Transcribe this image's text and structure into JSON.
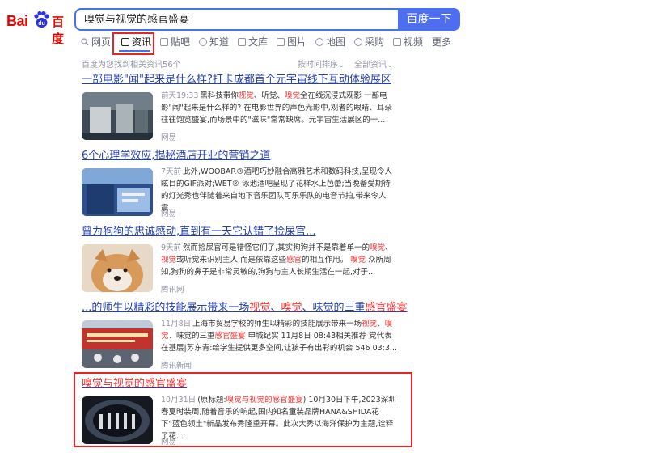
{
  "header": {
    "logo_left": "Bai",
    "logo_right": "百度",
    "search_value": "嗅觉与视觉的感官盛宴",
    "search_button": "百度一下"
  },
  "tabs": [
    {
      "label": "网页",
      "icon": "search-icon"
    },
    {
      "label": "资讯",
      "icon": "news-icon",
      "active": true
    },
    {
      "label": "贴吧",
      "icon": "tieba-icon"
    },
    {
      "label": "知道",
      "icon": "question-icon"
    },
    {
      "label": "文库",
      "icon": "doc-icon"
    },
    {
      "label": "图片",
      "icon": "image-icon"
    },
    {
      "label": "地图",
      "icon": "map-icon"
    },
    {
      "label": "采购",
      "icon": "purchase-icon"
    },
    {
      "label": "视频",
      "icon": "video-icon"
    },
    {
      "label": "更多",
      "icon": ""
    }
  ],
  "info": {
    "result_count": "百度为您找到相关资讯56个",
    "sort": "按时间排序",
    "filter": "全部资讯"
  },
  "results": [
    {
      "title_parts": [
        {
          "t": "一部电影\"闻\"起来是什么样?打卡成都首个元宇宙线下互动体验展区",
          "hl": false
        }
      ],
      "time": "前天19:33",
      "snippet_parts": [
        {
          "t": "黑科技带你",
          "hl": false
        },
        {
          "t": "视觉",
          "hl": true
        },
        {
          "t": "、听觉、",
          "hl": false
        },
        {
          "t": "嗅觉",
          "hl": true
        },
        {
          "t": "全在线沉浸式观影 一部电影\"闻\"起来是什么样的? 在电影世界的声色光影中,观者的眼睛、耳朵往往饱览盛宴,而场景中的\"滋味\"常常缺席。元宇宙生活展区的一...",
          "hl": false
        }
      ],
      "source": "网易"
    },
    {
      "title_parts": [
        {
          "t": "6个心理学效应,揭秘酒店开业的营销之道",
          "hl": false
        }
      ],
      "time": "7天前",
      "snippet_parts": [
        {
          "t": "此外,WOOBAR®酒吧巧妙融合高雅艺术和数码科技,呈现令人眩目的GIF派对;WET® 泳池酒吧呈现了花样水上芭蕾;当晚备受期待的灯光秀也伴随着来自地下音乐团队可乐乐队的电音节拍,带来令人震...",
          "hl": false
        }
      ],
      "source": "网易"
    },
    {
      "title_parts": [
        {
          "t": "曾为狗狗的忠诚感动,直到有一天它认错了捡屎官...",
          "hl": false
        }
      ],
      "time": "9天前",
      "snippet_parts": [
        {
          "t": "然而捡屎官可是错怪它们了,其实狗狗并不是靠着单一的",
          "hl": false
        },
        {
          "t": "嗅觉",
          "hl": true
        },
        {
          "t": "、",
          "hl": false
        },
        {
          "t": "视觉",
          "hl": true
        },
        {
          "t": "或听觉来识别主人,而是依靠这些",
          "hl": false
        },
        {
          "t": "感官",
          "hl": true
        },
        {
          "t": "的相互作用。 ",
          "hl": false
        },
        {
          "t": "嗅觉",
          "hl": true
        },
        {
          "t": " 众所周知,狗狗的鼻子是非常灵敏的,狗狗与主人长期生活在一起,对于...",
          "hl": false
        }
      ],
      "source": "腾讯网"
    },
    {
      "title_parts": [
        {
          "t": "...的师生以精彩的技能展示带来一场",
          "hl": false
        },
        {
          "t": "视觉",
          "hl": true
        },
        {
          "t": "、",
          "hl": false
        },
        {
          "t": "嗅觉",
          "hl": true
        },
        {
          "t": "、味觉的三重",
          "hl": false
        },
        {
          "t": "感官盛宴",
          "hl": true
        }
      ],
      "time": "11月8日",
      "snippet_parts": [
        {
          "t": "上海市贸易学校的师生以精彩的技能展示带来一场",
          "hl": false
        },
        {
          "t": "视觉",
          "hl": true
        },
        {
          "t": "、",
          "hl": false
        },
        {
          "t": "嗅觉",
          "hl": true
        },
        {
          "t": "、味觉的三重",
          "hl": false
        },
        {
          "t": "感官盛宴",
          "hl": true
        },
        {
          "t": " 申城纪实 11月8日 08:43相关推荐 党代表在基层|苏东青:给学生提供更多空间,让孩子有出彩的机会 546 03:3...",
          "hl": false
        }
      ],
      "source": "腾讯新闻"
    },
    {
      "title_parts": [
        {
          "t": "嗅觉与视觉的感官盛宴",
          "hl": true
        }
      ],
      "time": "10月31日",
      "snippet_parts": [
        {
          "t": "(原标题:",
          "hl": false
        },
        {
          "t": "嗅觉与视觉的感官盛宴",
          "hl": true
        },
        {
          "t": ") 10月30日下午,2023深圳春夏时装周,随着音乐的响起,国内知名童装品牌HANA&SHIDA花下\"蓝色领土\"新品发布秀隆重开幕。此次大秀以海洋保护为主题,诠释了花...",
          "hl": false
        }
      ],
      "source": "网易"
    }
  ],
  "colors": {
    "accent": "#4e6ef2",
    "link": "#2440b3",
    "highlight": "#f73131",
    "annotation": "#e5252a"
  }
}
